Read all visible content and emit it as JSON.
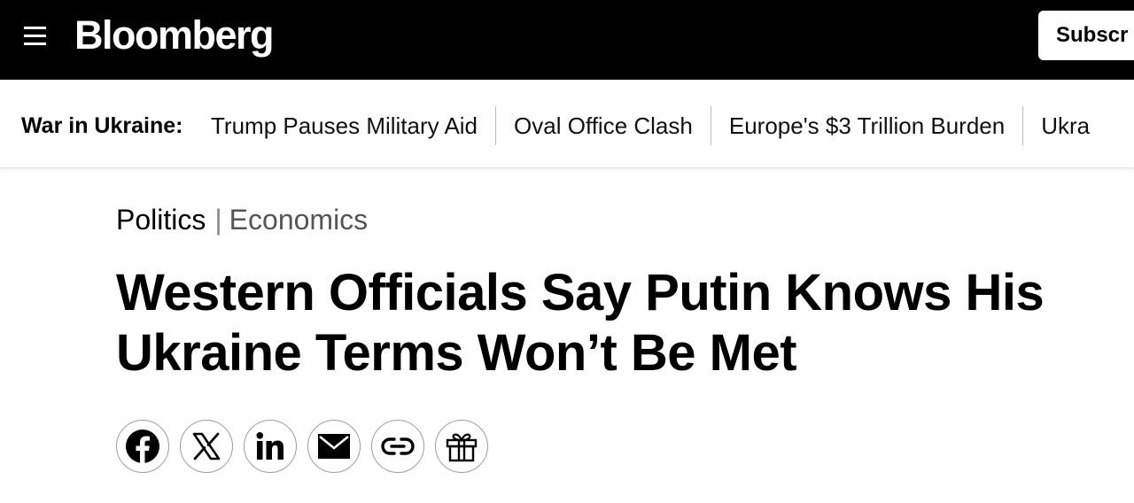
{
  "header": {
    "logo_text": "Bloomberg",
    "subscribe_label": "Subscr"
  },
  "topic_bar": {
    "label": "War in Ukraine:",
    "links": [
      "Trump Pauses Military Aid",
      "Oval Office Clash",
      "Europe's $3 Trillion Burden",
      "Ukra"
    ]
  },
  "article": {
    "kicker_primary": "Politics",
    "kicker_divider": "|",
    "kicker_secondary": "Economics",
    "headline_line1": "Western Officials Say Putin Knows His",
    "headline_line2": "Ukraine Terms Won’t Be Met"
  },
  "share_buttons": [
    {
      "icon": "facebook-icon"
    },
    {
      "icon": "x-icon"
    },
    {
      "icon": "linkedin-icon"
    },
    {
      "icon": "email-icon"
    },
    {
      "icon": "link-icon"
    },
    {
      "icon": "gift-icon"
    }
  ],
  "colors": {
    "header_bg": "#000000",
    "text": "#000000",
    "secondary_text": "#555555"
  }
}
